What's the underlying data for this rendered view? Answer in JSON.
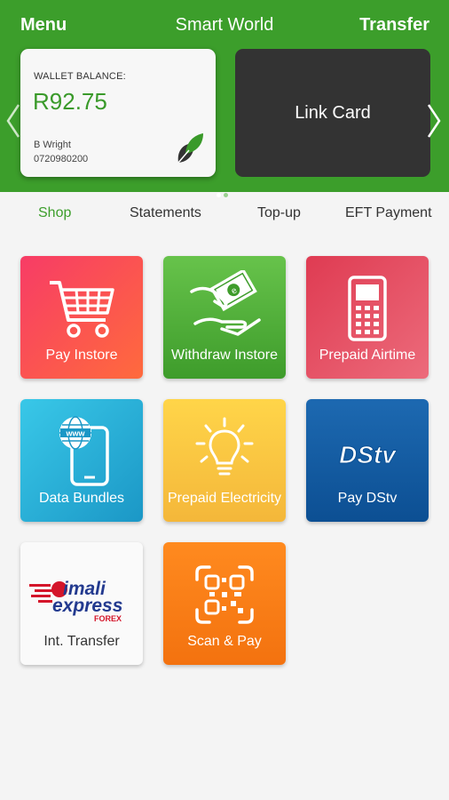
{
  "header": {
    "menu_label": "Menu",
    "title": "Smart World",
    "transfer_label": "Transfer",
    "background_color": "#3c9e2b"
  },
  "carousel": {
    "wallet_card": {
      "label": "WALLET BALANCE:",
      "balance": "R92.75",
      "name": "B Wright",
      "phone": "0720980200",
      "icon": "leaf-logo-icon"
    },
    "link_card": {
      "label": "Link Card"
    },
    "prev_icon": "chevron-left-icon",
    "next_icon": "chevron-right-icon",
    "page_count": 2,
    "active_page": 1
  },
  "tabs": [
    {
      "label": "Shop",
      "active": true
    },
    {
      "label": "Statements",
      "active": false
    },
    {
      "label": "Top-up",
      "active": false
    },
    {
      "label": "EFT Payment",
      "active": false
    }
  ],
  "tiles": [
    {
      "label": "Pay Instore",
      "icon": "shopping-cart-icon"
    },
    {
      "label": "Withdraw Instore",
      "icon": "cash-hand-icon"
    },
    {
      "label": "Prepaid Airtime",
      "icon": "mobile-phone-icon"
    },
    {
      "label": "Data Bundles",
      "icon": "globe-phone-icon"
    },
    {
      "label": "Prepaid Electricity",
      "icon": "light-bulb-icon"
    },
    {
      "label": "Pay DStv",
      "icon": "dstv-logo-icon",
      "logo_text": "DStv"
    },
    {
      "label": "Int. Transfer",
      "icon": "imali-express-logo-icon",
      "logo_text": [
        "imali",
        "express",
        "FOREX"
      ]
    },
    {
      "label": "Scan & Pay",
      "icon": "qr-scan-icon"
    }
  ],
  "colors": {
    "accent": "#3c9e2b",
    "tab_active": "#3c9e2b",
    "balance": "#3a9a2a"
  }
}
